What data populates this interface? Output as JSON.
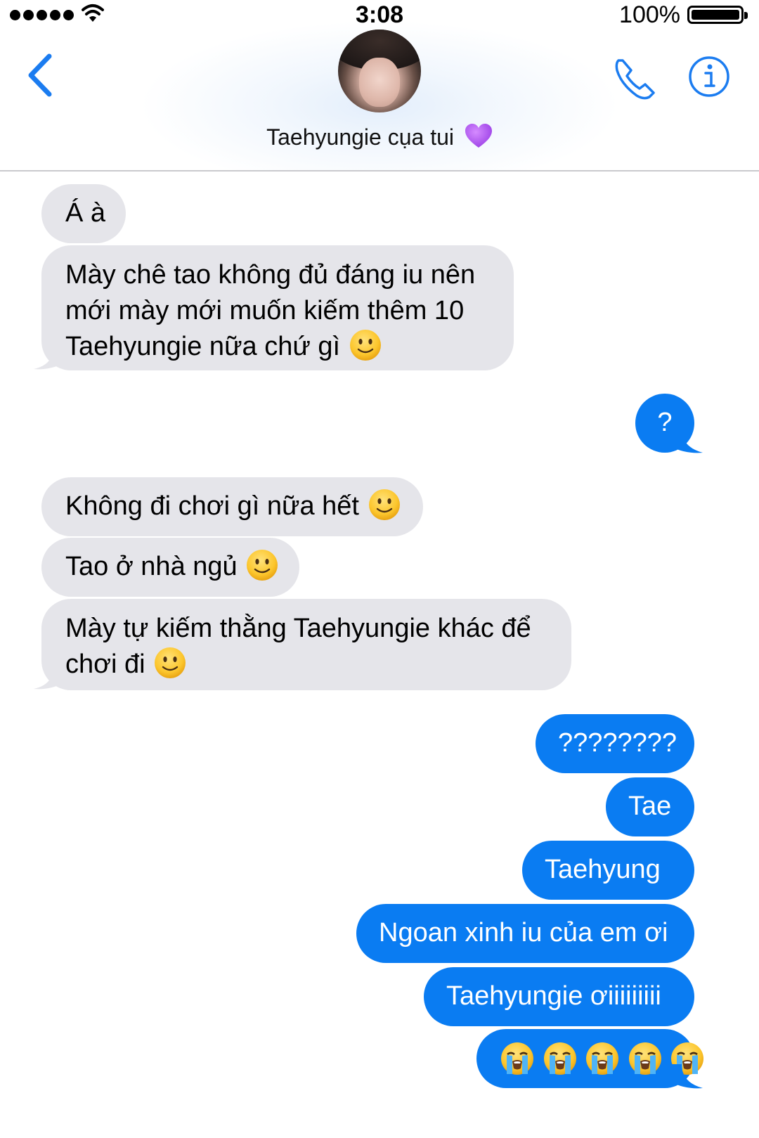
{
  "status_bar": {
    "time": "3:08",
    "battery_percent": "100%",
    "signal_bars": 5
  },
  "header": {
    "contact_name": "Taehyungie cụa tui",
    "contact_emoji": "purple-heart",
    "back_icon": "chevron-left-icon",
    "call_icon": "phone-icon",
    "info_icon": "info-icon"
  },
  "messages": [
    {
      "side": "incoming",
      "text": "Á à"
    },
    {
      "side": "incoming",
      "text": "Mày chê tao không đủ đáng iu nên mới mày mới muốn kiếm thêm 10 Taehyungie nữa chứ gì",
      "emoji": "slightly-smiling-face"
    },
    {
      "side": "outgoing",
      "text": "?"
    },
    {
      "side": "incoming",
      "text": "Không đi chơi gì nữa hết",
      "emoji": "slightly-smiling-face"
    },
    {
      "side": "incoming",
      "text": "Tao ở nhà ngủ",
      "emoji": "slightly-smiling-face"
    },
    {
      "side": "incoming",
      "text": "Mày tự kiếm thằng Taehyungie khác để chơi đi",
      "emoji": "slightly-smiling-face"
    },
    {
      "side": "outgoing",
      "text": "????????"
    },
    {
      "side": "outgoing",
      "text": "Tae"
    },
    {
      "side": "outgoing",
      "text": "Taehyung"
    },
    {
      "side": "outgoing",
      "text": "Ngoan xinh iu của em ơi"
    },
    {
      "side": "outgoing",
      "text": "Taehyungie ơiiiiiiiii"
    },
    {
      "side": "outgoing",
      "text": "",
      "emoji": "loudly-crying-face",
      "emoji_count": 5
    }
  ],
  "colors": {
    "incoming_bubble": "#e5e5ea",
    "outgoing_bubble": "#0a7cf2",
    "accent": "#1b7cf0"
  }
}
